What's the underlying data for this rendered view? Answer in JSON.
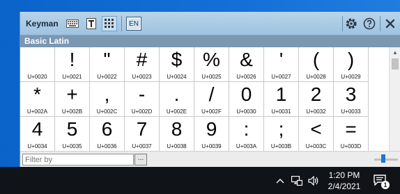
{
  "window": {
    "title": "Keyman",
    "language_button": "EN",
    "section_header": "Basic Latin"
  },
  "toolbar": {
    "icons": [
      "keyboard-icon",
      "text-format-icon",
      "character-map-icon",
      "gear-icon",
      "help-icon",
      "close-icon"
    ],
    "active_tool": "character-map-icon"
  },
  "characters": [
    {
      "glyph": " ",
      "code": "U+0020"
    },
    {
      "glyph": "!",
      "code": "U+0021"
    },
    {
      "glyph": "\"",
      "code": "U+0022"
    },
    {
      "glyph": "#",
      "code": "U+0023"
    },
    {
      "glyph": "$",
      "code": "U+0024"
    },
    {
      "glyph": "%",
      "code": "U+0025"
    },
    {
      "glyph": "&",
      "code": "U+0026"
    },
    {
      "glyph": "'",
      "code": "U+0027"
    },
    {
      "glyph": "(",
      "code": "U+0028"
    },
    {
      "glyph": ")",
      "code": "U+0029"
    },
    {
      "glyph": "*",
      "code": "U+002A"
    },
    {
      "glyph": "+",
      "code": "U+002B"
    },
    {
      "glyph": ",",
      "code": "U+002C"
    },
    {
      "glyph": "-",
      "code": "U+002D"
    },
    {
      "glyph": ".",
      "code": "U+002E"
    },
    {
      "glyph": "/",
      "code": "U+002F"
    },
    {
      "glyph": "0",
      "code": "U+0030"
    },
    {
      "glyph": "1",
      "code": "U+0031"
    },
    {
      "glyph": "2",
      "code": "U+0032"
    },
    {
      "glyph": "3",
      "code": "U+0033"
    },
    {
      "glyph": "4",
      "code": "U+0034"
    },
    {
      "glyph": "5",
      "code": "U+0035"
    },
    {
      "glyph": "6",
      "code": "U+0036"
    },
    {
      "glyph": "7",
      "code": "U+0037"
    },
    {
      "glyph": "8",
      "code": "U+0038"
    },
    {
      "glyph": "9",
      "code": "U+0039"
    },
    {
      "glyph": ":",
      "code": "U+003A"
    },
    {
      "glyph": ";",
      "code": "U+003B"
    },
    {
      "glyph": "<",
      "code": "U+003C"
    },
    {
      "glyph": "=",
      "code": "U+003D"
    }
  ],
  "filter": {
    "placeholder": "Filter by",
    "button_label": "..."
  },
  "taskbar": {
    "time": "1:20 PM",
    "date": "2/4/2021",
    "notification_count": "1",
    "tray_icons": [
      "chevron-up-icon",
      "network-icon",
      "volume-icon",
      "notification-icon"
    ]
  },
  "colors": {
    "toolbar_bg": "#a9cbe6",
    "header_bg": "#7b97b2",
    "desktop_bg": "#1470d8",
    "taskbar_bg": "#101418",
    "accent": "#1e77d2"
  }
}
